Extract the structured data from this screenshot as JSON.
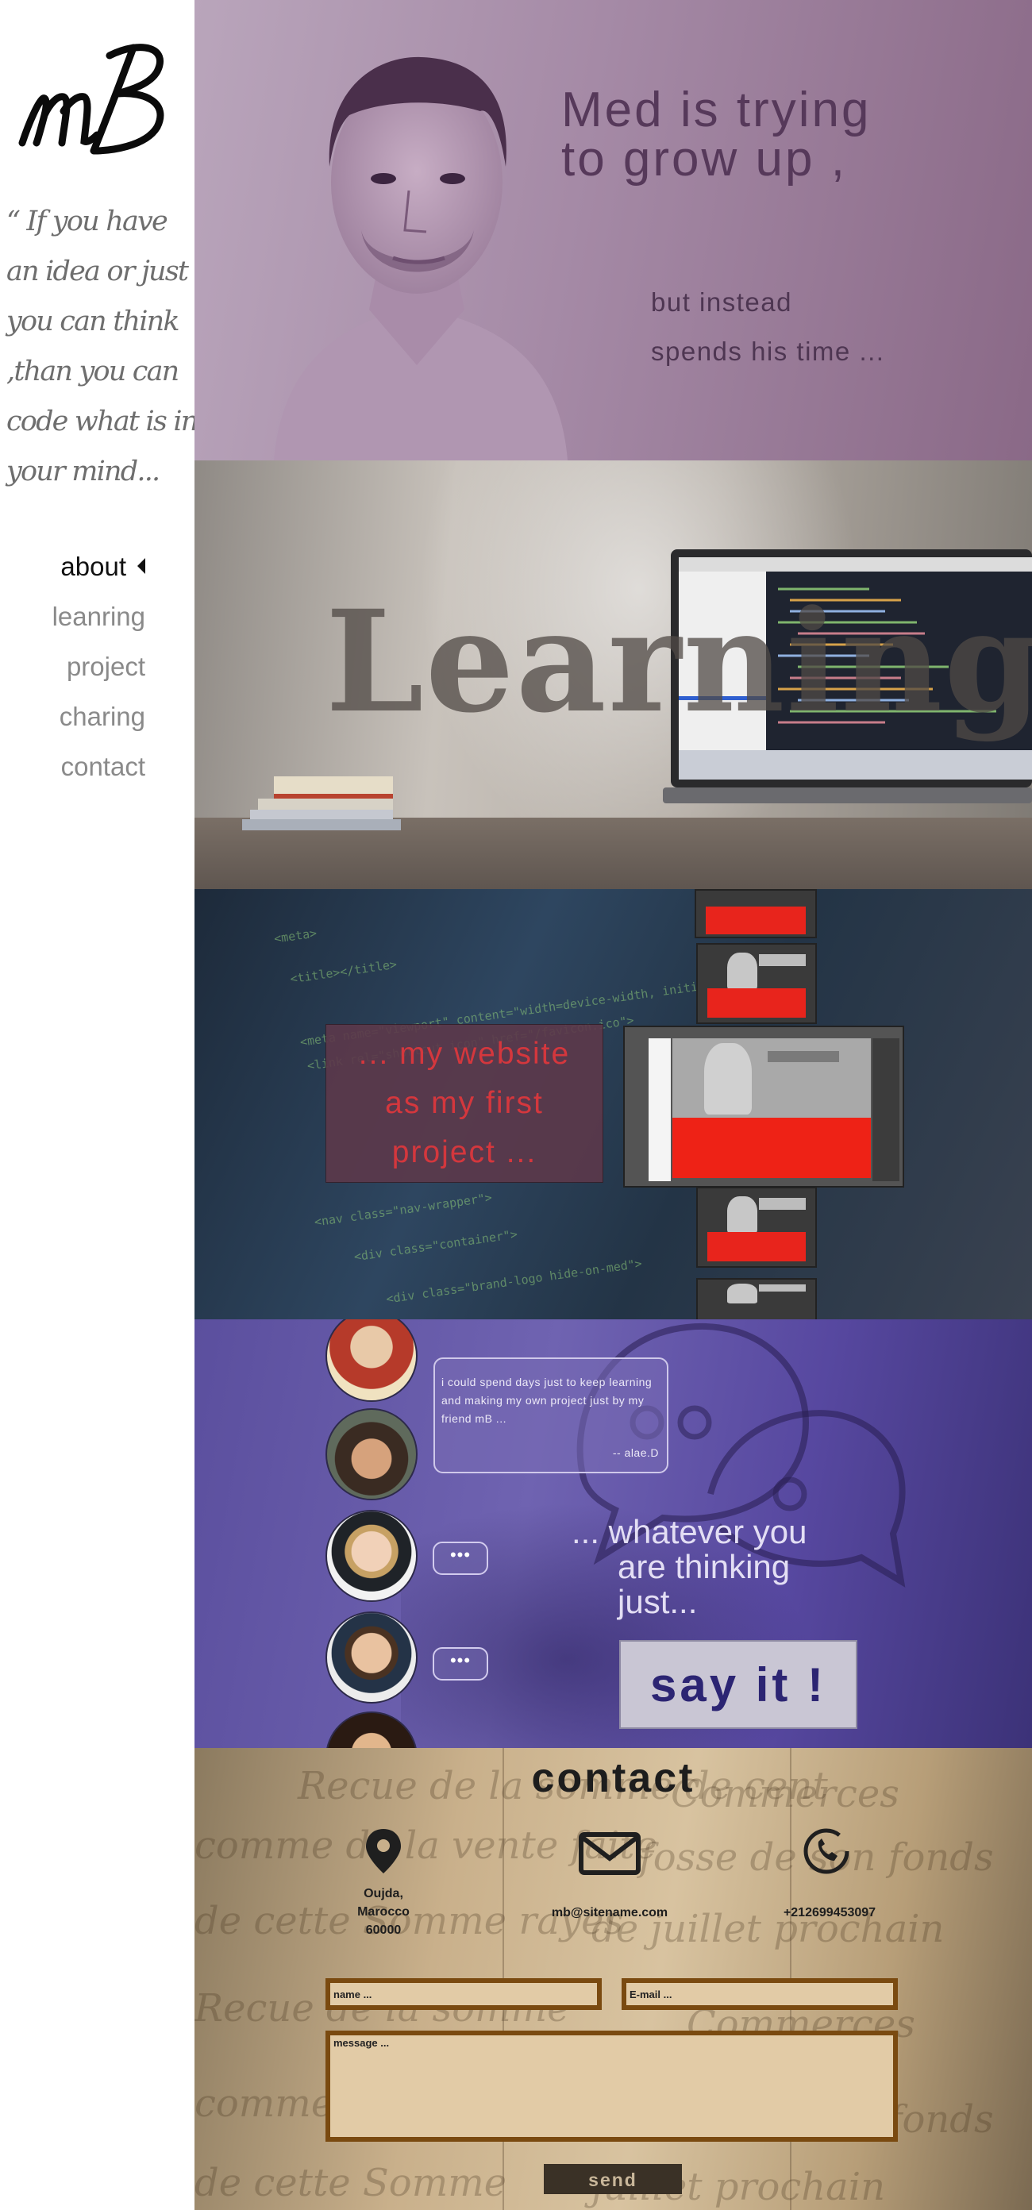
{
  "sidebar": {
    "logo_text": "mB",
    "quote_lines": [
      "“ If you have",
      "an idea or just",
      "you can think",
      ",than you can",
      "code what is in",
      "your mind..."
    ],
    "nav": [
      {
        "label": "about",
        "active": true
      },
      {
        "label": "leanring",
        "active": false
      },
      {
        "label": "project",
        "active": false
      },
      {
        "label": "charing",
        "active": false
      },
      {
        "label": "contact",
        "active": false
      }
    ]
  },
  "hero": {
    "title_line1": "Med is trying",
    "title_line2": "to grow up ,",
    "sub_line1": "but instead",
    "sub_line2": "spends his time ..."
  },
  "learning": {
    "title": "Learning"
  },
  "project": {
    "line1": "... my website",
    "line2": "as my first",
    "line3": "project ..."
  },
  "testimonial": {
    "quote": "i could spend days just to keep learning and making my own project just by my friend mB ...",
    "author": "-- alae.D",
    "dots": "•••",
    "think_line1": "... whatever you",
    "think_line2": "are thinking",
    "think_line3": "just...",
    "cta": "say it  !"
  },
  "contact": {
    "title": "contact",
    "address_line1": "Oujda,",
    "address_line2": "Marocco",
    "address_line3": "60000",
    "email": "mb@sitename.com",
    "phone": "+212699453097",
    "name_placeholder": "name ...",
    "email_placeholder": "E-mail ...",
    "message_placeholder": "message ...",
    "send_label": "send"
  },
  "colors": {
    "hero_text": "#56395a",
    "project_text": "#d4373d",
    "cta_text": "#2c2573",
    "field_border": "#7a4a10"
  }
}
